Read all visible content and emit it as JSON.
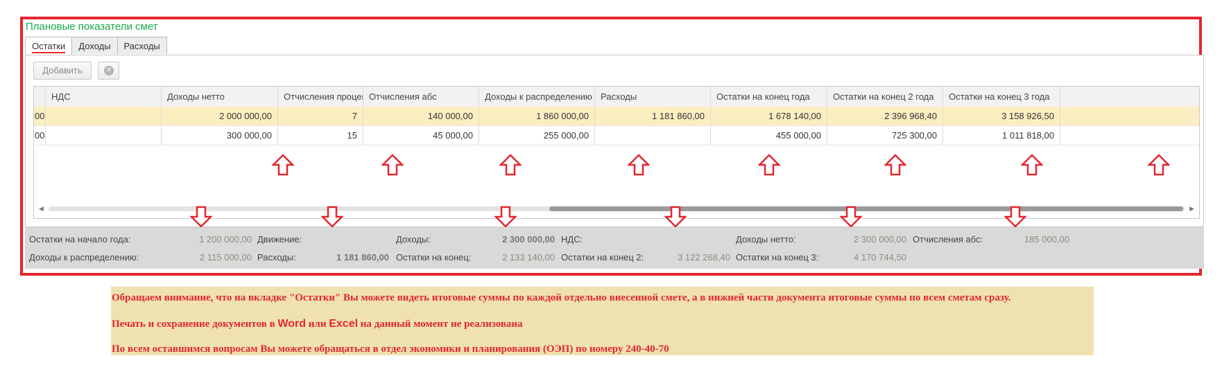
{
  "form_title": "Плановые показатели смет",
  "tabs": [
    {
      "label": "Остатки",
      "active": true
    },
    {
      "label": "Доходы",
      "active": false
    },
    {
      "label": "Расходы",
      "active": false
    }
  ],
  "toolbar": {
    "add_label": "Добавить",
    "delete_icon": "close-circle-icon"
  },
  "table": {
    "columns": [
      "",
      "НДС",
      "Доходы нетто",
      "Отчисления процент",
      "Отчисления абс",
      "Доходы к распределению",
      "Расходы",
      "Остатки на конец года",
      "Остатки на конец 2 года",
      "Остатки на конец 3 года"
    ],
    "rows": [
      [
        "00",
        "",
        "2 000 000,00",
        "7",
        "140 000,00",
        "1 860 000,00",
        "1 181 860,00",
        "1 678 140,00",
        "2 396 968,40",
        "3 158 926,50"
      ],
      [
        "00",
        "",
        "300 000,00",
        "15",
        "45 000,00",
        "255 000,00",
        "",
        "455 000,00",
        "725 300,00",
        "1 011 818,00"
      ]
    ]
  },
  "totals": {
    "start_year_label": "Остатки на начало года:",
    "start_year_value": "1 200 000,00",
    "movement_label": "Движение:",
    "income_label": "Доходы:",
    "income_value": "2 300 000,00",
    "vat_label": "НДС:",
    "net_income_label": "Доходы нетто:",
    "net_income_value": "2 300 000,00",
    "deductions_label": "Отчисления абс:",
    "deductions_value": "185 000,00",
    "distribution_label": "Доходы к распределению:",
    "distribution_value": "2 115 000,00",
    "expenses_label": "Расходы:",
    "expenses_value": "1 181 860,00",
    "end_label": "Остатки на конец:",
    "end_value": "2 133 140,00",
    "end2_label": "Остатки на конец 2:",
    "end2_value": "3 122 268,40",
    "end3_label": "Остатки на конец 3:",
    "end3_value": "4 170 744,50"
  },
  "note": {
    "line1": "Обращаем внимание, что на вкладке \"Остатки\" Вы можете видеть итоговые суммы по каждой отдельно внесенной смете, а в нижней части документа итоговые суммы по всем сметам сразу.",
    "line2_a": "Печать и сохранение документов в ",
    "line2_word": "Word",
    "line2_b": " или ",
    "line2_excel": "Excel",
    "line2_c": " на данный момент не реализована",
    "line3": "По всем оставшимся вопросам Вы можете обращаться в отдел экономики и планирования (ОЭП) по номеру 240-40-70"
  },
  "colors": {
    "highlight_border": "#e3262f",
    "title_green": "#1aa84a",
    "selected_row": "#fbeec1",
    "note_bg": "#efe2b0"
  }
}
